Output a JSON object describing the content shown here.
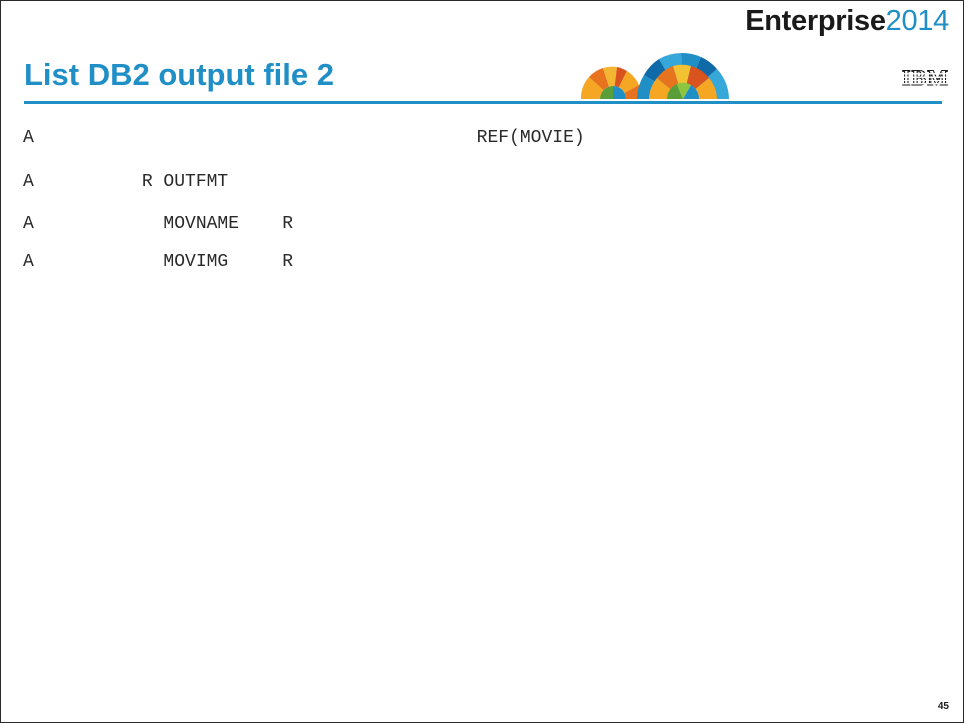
{
  "header": {
    "brand_bold": "Enterprise",
    "brand_year": "2014",
    "ibm_logo_text": "IBM",
    "logo_graphic": "enterprise-sunburst-logo",
    "accent_color": "#1f8fc6"
  },
  "slide": {
    "title": "List DB2 output file 2",
    "page_number": "45"
  },
  "code_lines": [
    "A                                         REF(MOVIE)",
    "A          R OUTFMT",
    "A            MOVNAME    R",
    "A            MOVIMG     R"
  ]
}
